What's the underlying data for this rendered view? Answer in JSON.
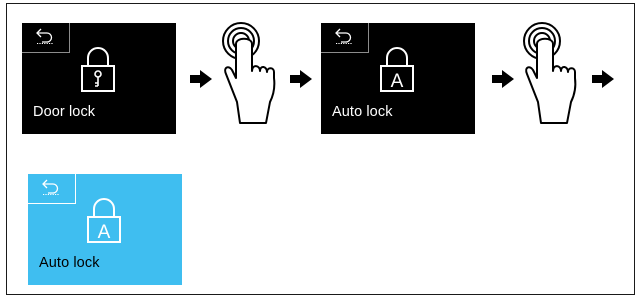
{
  "screens": [
    {
      "label": "Door lock",
      "icon": "padlock-key-icon",
      "background": "#000000"
    },
    {
      "label": "Auto lock",
      "icon": "padlock-a-icon",
      "background": "#000000",
      "glyph": "A"
    },
    {
      "label": "Auto lock",
      "icon": "padlock-a-icon",
      "background": "#3fbef0",
      "glyph": "A"
    }
  ],
  "colors": {
    "active_screen": "#3fbef0",
    "inactive_screen": "#000000",
    "arrow": "#000000"
  }
}
